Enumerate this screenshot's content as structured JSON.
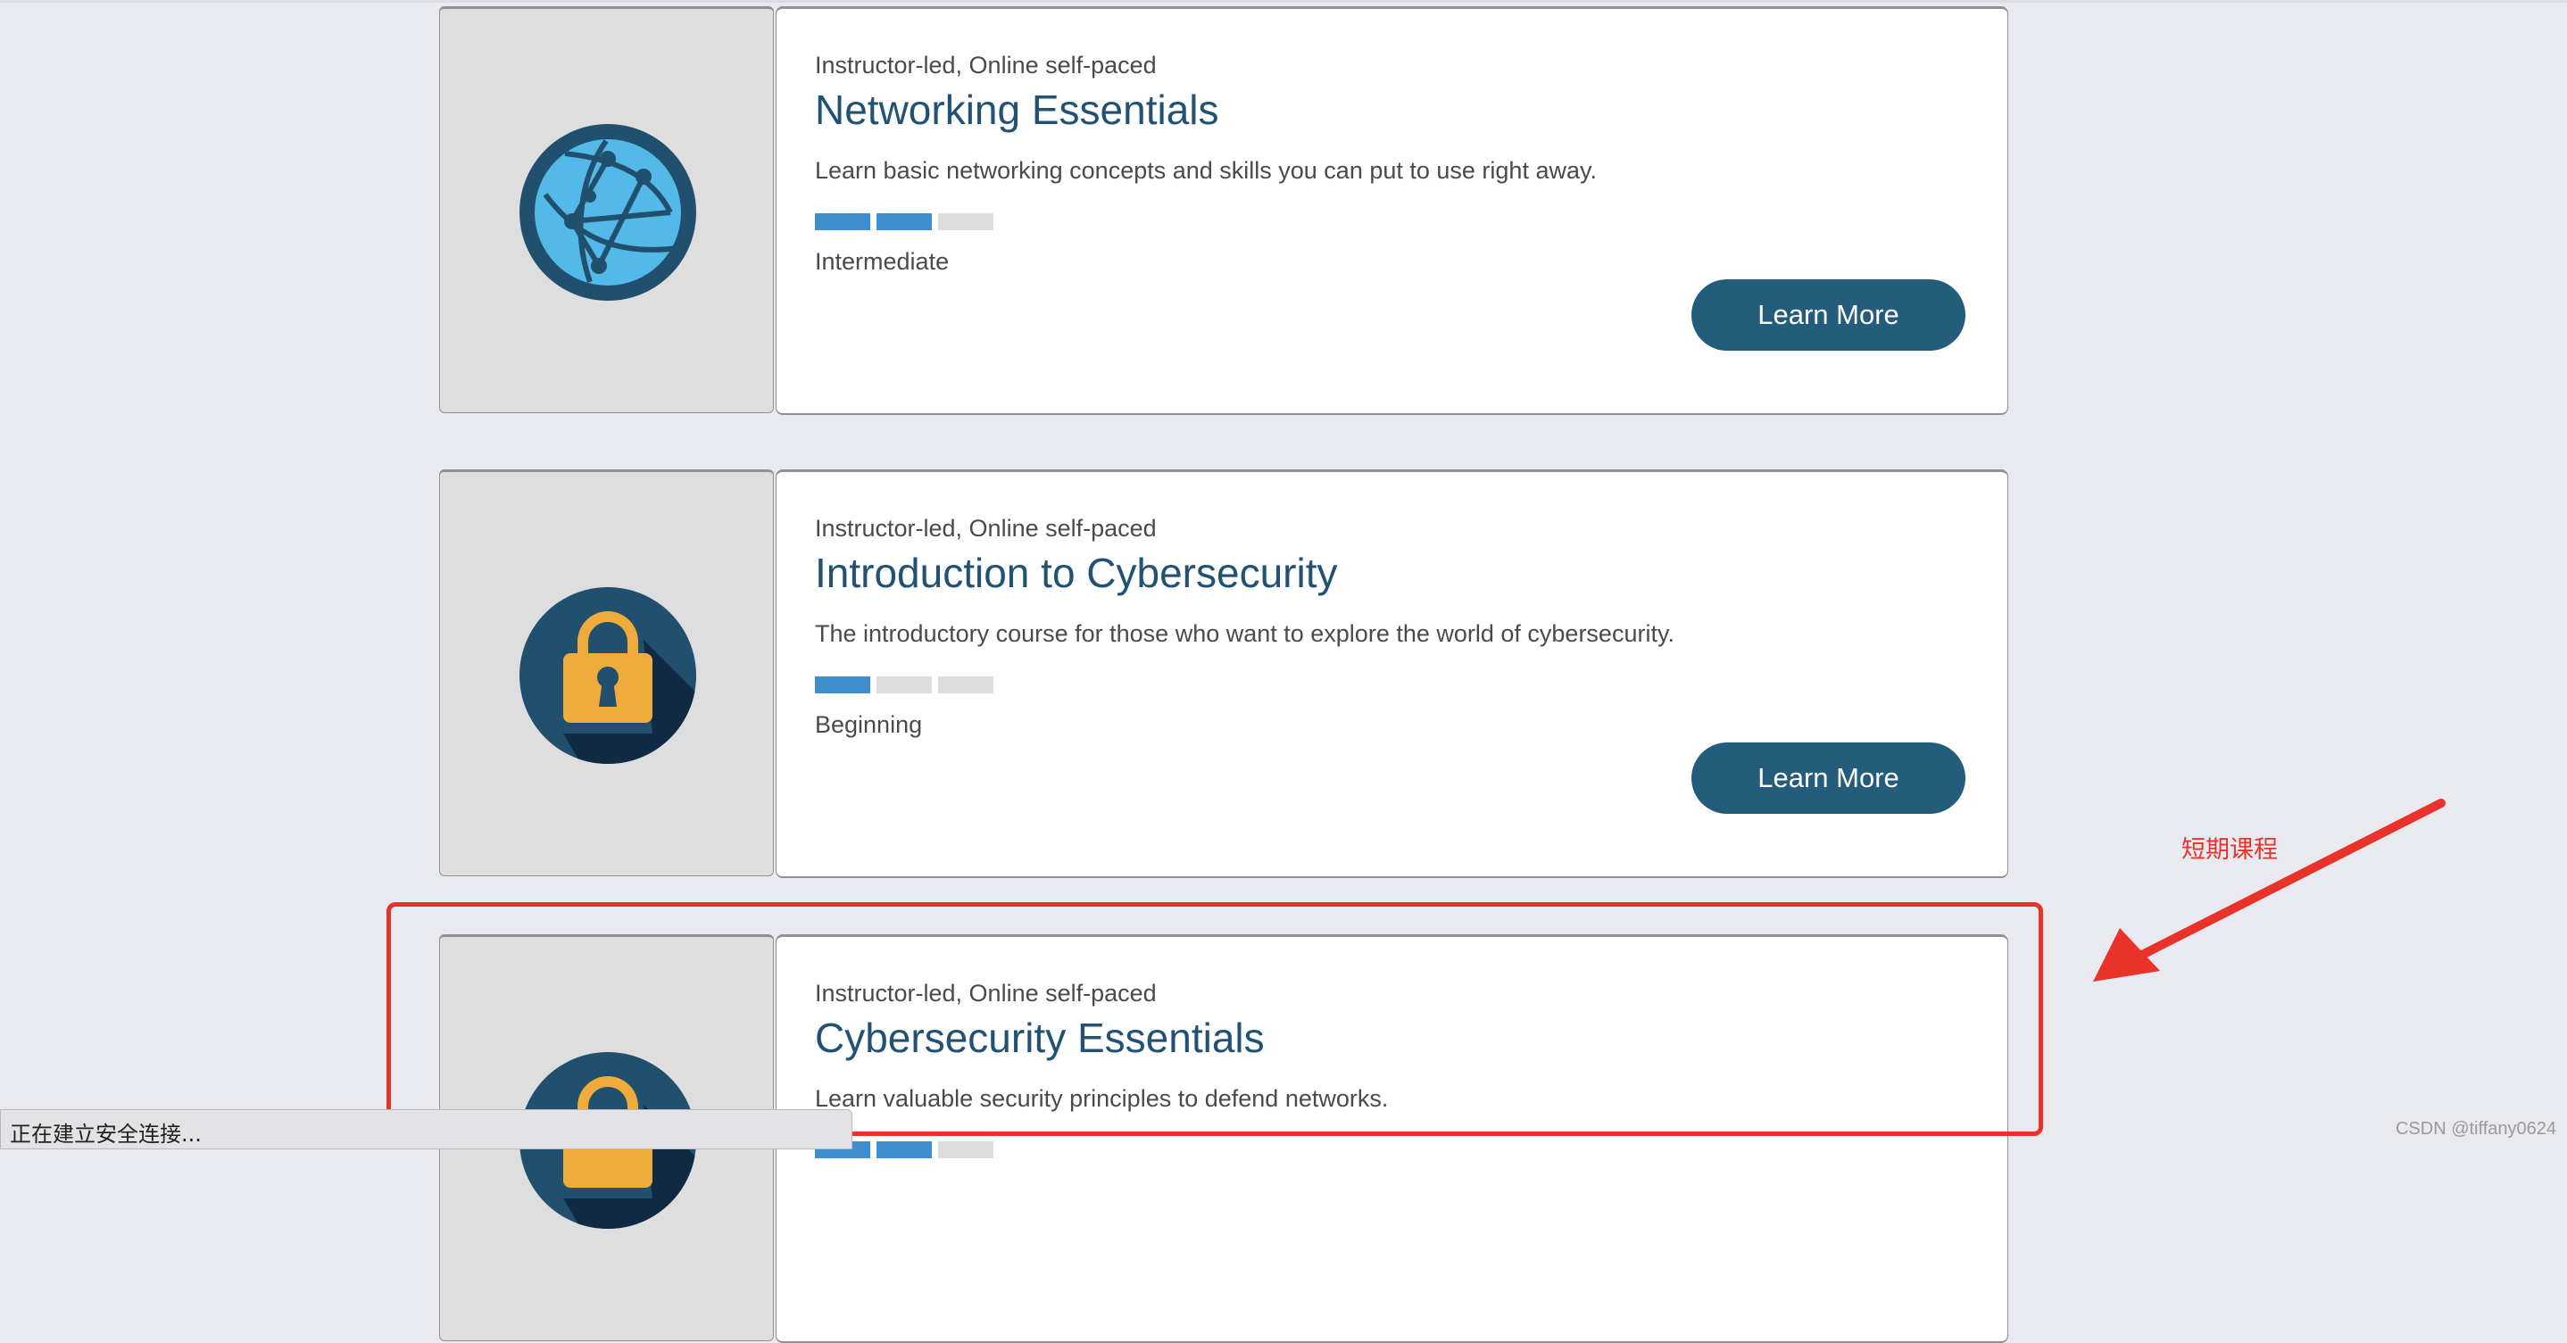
{
  "courses": [
    {
      "delivery": "Instructor-led, Online self-paced",
      "title": "Networking Essentials",
      "description": "Learn basic networking concepts and skills you can put to use right away.",
      "level": "Intermediate",
      "level_value": 2,
      "level_max": 3,
      "button": "Learn More",
      "icon": "globe-network-icon"
    },
    {
      "delivery": "Instructor-led, Online self-paced",
      "title": "Introduction to Cybersecurity",
      "description": "The introductory course for those who want to explore the world of cybersecurity.",
      "level": "Beginning",
      "level_value": 1,
      "level_max": 3,
      "button": "Learn More",
      "icon": "padlock-icon"
    },
    {
      "delivery": "Instructor-led, Online self-paced",
      "title": "Cybersecurity Essentials",
      "description": "Learn valuable security principles to defend networks.",
      "level_value": 2,
      "level_max": 3,
      "icon": "padlock-icon"
    }
  ],
  "annotation": {
    "label": "短期课程",
    "color": "#e8322a"
  },
  "status_bar": {
    "text": "正在建立安全连接..."
  },
  "watermark": "CSDN @tiffany0624",
  "colors": {
    "title": "#215273",
    "button": "#245d7c",
    "level_on": "#3f8fcf",
    "level_off": "#dcdcdc"
  }
}
